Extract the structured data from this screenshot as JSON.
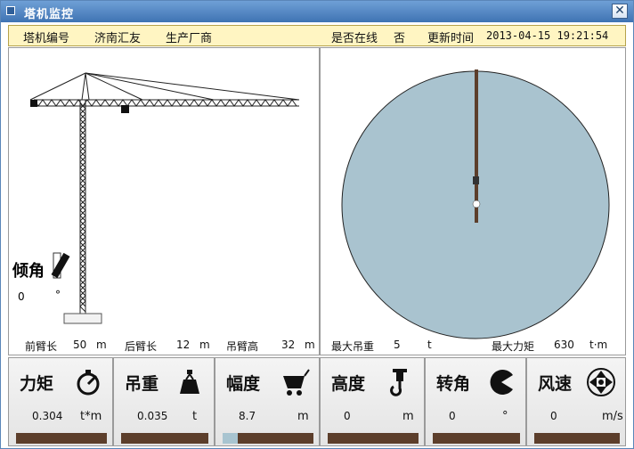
{
  "window": {
    "title": "塔机监控",
    "close_glyph": "✕"
  },
  "info": {
    "id_label": "塔机编号",
    "id_value": "济南汇友",
    "maker_label": "生产厂商",
    "online_label": "是否在线",
    "online_value": "否",
    "update_label": "更新时间",
    "update_value": "2013-04-15 19:21:54"
  },
  "tower": {
    "tilt_label": "倾角",
    "tilt_value": "0",
    "tilt_unit": "°",
    "front_arm_label": "前臂长",
    "front_arm_value": "50",
    "front_arm_unit": "m",
    "rear_arm_label": "后臂长",
    "rear_arm_value": "12",
    "rear_arm_unit": "m",
    "arm_height_label": "吊臂高",
    "arm_height_value": "32",
    "arm_height_unit": "m"
  },
  "radar": {
    "max_load_label": "最大吊重",
    "max_load_value": "5",
    "max_load_unit": "t",
    "max_moment_label": "最大力矩",
    "max_moment_value": "630",
    "max_moment_unit": "t·m",
    "color": "#a9c3cf"
  },
  "metrics": [
    {
      "label": "力矩",
      "value": "0.304",
      "unit": "t*m",
      "icon": "gauge-icon",
      "level": 0.0
    },
    {
      "label": "吊重",
      "value": "0.035",
      "unit": "t",
      "icon": "weight-icon",
      "level": 0.0
    },
    {
      "label": "幅度",
      "value": "8.7",
      "unit": "m",
      "icon": "cart-icon",
      "level": 0.17
    },
    {
      "label": "高度",
      "value": "0",
      "unit": "m",
      "icon": "hook-icon",
      "level": 0.0
    },
    {
      "label": "转角",
      "value": "0",
      "unit": "°",
      "icon": "pacman-icon",
      "level": 0.0
    },
    {
      "label": "风速",
      "value": "0",
      "unit": "m/s",
      "icon": "fan-icon",
      "level": 0.0
    }
  ]
}
